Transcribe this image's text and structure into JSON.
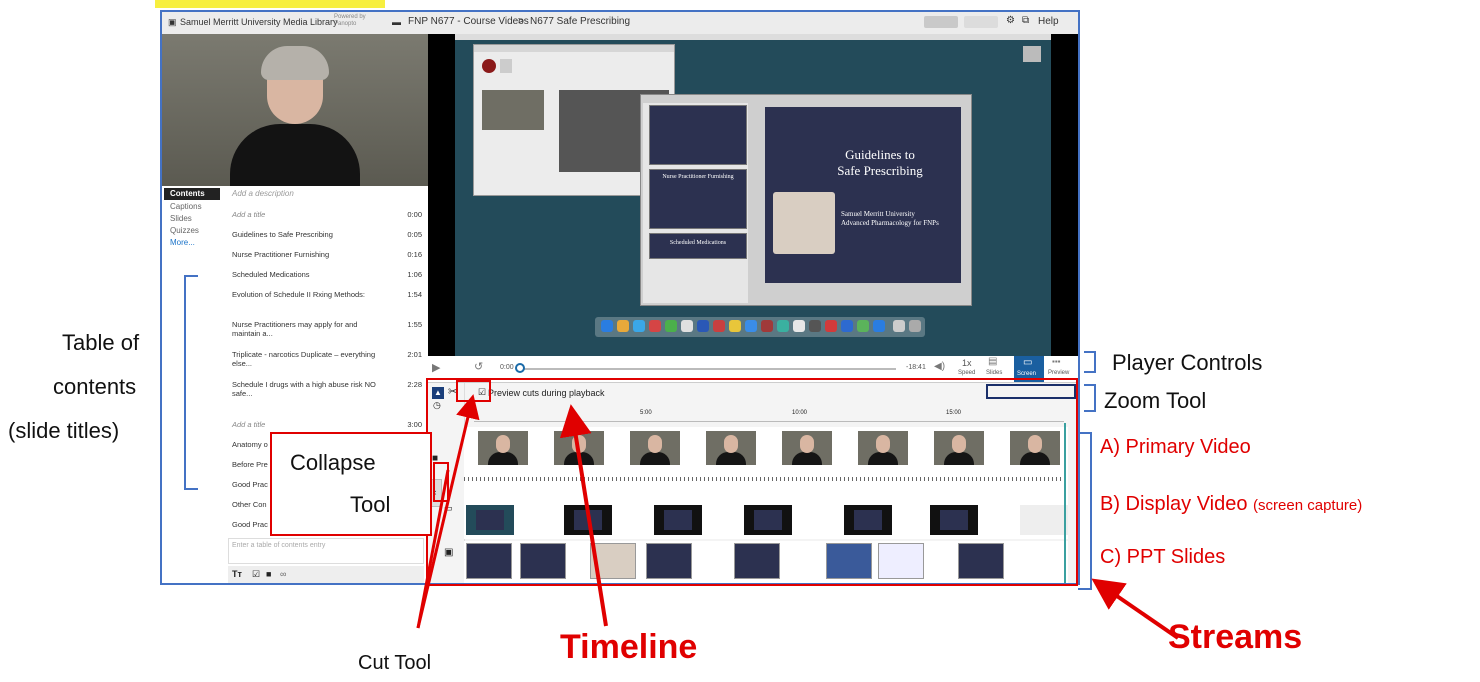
{
  "topbar": {
    "library": "Samuel Merritt University Media Library",
    "powered_by": "Powered by Panopto",
    "breadcrumb_folder": "FNP N677 - Course Videos",
    "breadcrumb_sep": ">",
    "breadcrumb_session": "N677 Safe Prescribing",
    "help": "Help"
  },
  "sidenav": [
    "Contents",
    "Captions",
    "Slides",
    "Quizzes",
    "More..."
  ],
  "description_placeholder": "Add a description",
  "toc": [
    {
      "title": "Add a title",
      "time": "0:00",
      "placeholder": true
    },
    {
      "title": "Guidelines to Safe Prescribing",
      "time": "0:05"
    },
    {
      "title": "Nurse Practitioner Furnishing",
      "time": "0:16"
    },
    {
      "title": "Scheduled Medications",
      "time": "1:06"
    },
    {
      "title": "Evolution of Schedule II Rxing Methods:",
      "time": "1:54"
    },
    {
      "title": "Nurse Practitioners may apply for and maintain a...",
      "time": "1:55"
    },
    {
      "title": "Triplicate - narcotics Duplicate – everything else...",
      "time": "2:01"
    },
    {
      "title": "Schedule I drugs with a high abuse risk NO safe...",
      "time": "2:28"
    },
    {
      "title": "Add a title",
      "time": "3:00",
      "placeholder": true
    },
    {
      "title": "Anatomy o",
      "time": ""
    },
    {
      "title": "Before Pre",
      "time": ""
    },
    {
      "title": "Good Prac",
      "time": ""
    },
    {
      "title": "Other Con",
      "time": ""
    },
    {
      "title": "Good Prac",
      "time": ""
    }
  ],
  "toc_entry_placeholder": "Enter a table of contents entry",
  "slide": {
    "title_line1": "Guidelines to",
    "title_line2": "Safe Prescribing",
    "subtitle_line1": "Samuel Merritt University",
    "subtitle_line2": "Advanced Pharmacology for FNPs"
  },
  "thumbs": {
    "t1": "Nurse Practitioner Furnishing",
    "t2": "Scheduled Medications"
  },
  "player": {
    "current_time": "0:00",
    "remaining": "-18:41",
    "speed": "1x",
    "speed_label": "Speed",
    "slides_label": "Slides",
    "screen_label": "Screen",
    "preview_label": "Preview"
  },
  "timeline": {
    "preview_cuts": "Preview cuts during playback",
    "ticks": [
      "5:00",
      "10:00",
      "15:00"
    ]
  },
  "annotations": {
    "toc_line1": "Table of",
    "toc_line2": "contents",
    "toc_line3": "(slide titles)",
    "player_controls": "Player Controls",
    "zoom_tool": "Zoom Tool",
    "primary": "A) Primary Video",
    "display": "B) Display Video",
    "display_sub": "(screen capture)",
    "ppt": "C) PPT Slides",
    "collapse1": "Collapse",
    "collapse2": "Tool",
    "timeline": "Timeline",
    "streams": "Streams",
    "cut_tool": "Cut Tool"
  },
  "colors": {
    "annotation_red": "#e00000",
    "frame_blue": "#4472c4",
    "slide_navy": "#2c3150"
  }
}
